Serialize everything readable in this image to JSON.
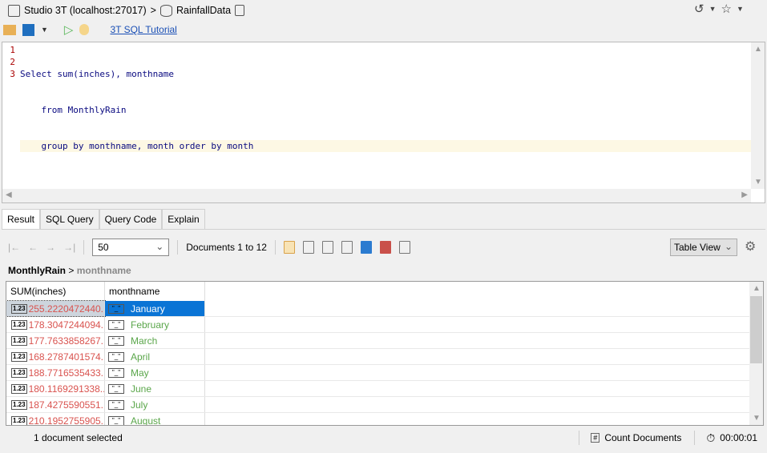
{
  "titlebar": {
    "connection": "Studio 3T (localhost:27017)",
    "database": "RainfallData"
  },
  "toolbar": {
    "tutorial_link": "3T SQL Tutorial"
  },
  "editor": {
    "lines": [
      {
        "num": "1",
        "text": "Select sum(inches), monthname"
      },
      {
        "num": "2",
        "text": "    from MonthlyRain"
      },
      {
        "num": "3",
        "text": "    group by monthname, month order by month"
      }
    ]
  },
  "tabs": [
    "Result",
    "SQL Query",
    "Query Code",
    "Explain"
  ],
  "result_toolbar": {
    "page_size": "50",
    "range": "Documents 1 to 12",
    "view": "Table View"
  },
  "breadcrumb": {
    "collection": "MonthlyRain",
    "field": "monthname"
  },
  "table": {
    "columns": [
      "SUM(inches)",
      "monthname"
    ],
    "rows": [
      [
        "255.2220472440...",
        "January"
      ],
      [
        "178.3047244094...",
        "February"
      ],
      [
        "177.7633858267...",
        "March"
      ],
      [
        "168.2787401574...",
        "April"
      ],
      [
        "188.7716535433...",
        "May"
      ],
      [
        "180.1169291338...",
        "June"
      ],
      [
        "187.4275590551...",
        "July"
      ],
      [
        "210.1952755905...",
        "August"
      ]
    ],
    "number_badge": "1.23",
    "string_badge": "\"_\""
  },
  "status": {
    "selection": "1 document selected",
    "count_button": "Count Documents",
    "timer": "00:00:01"
  }
}
